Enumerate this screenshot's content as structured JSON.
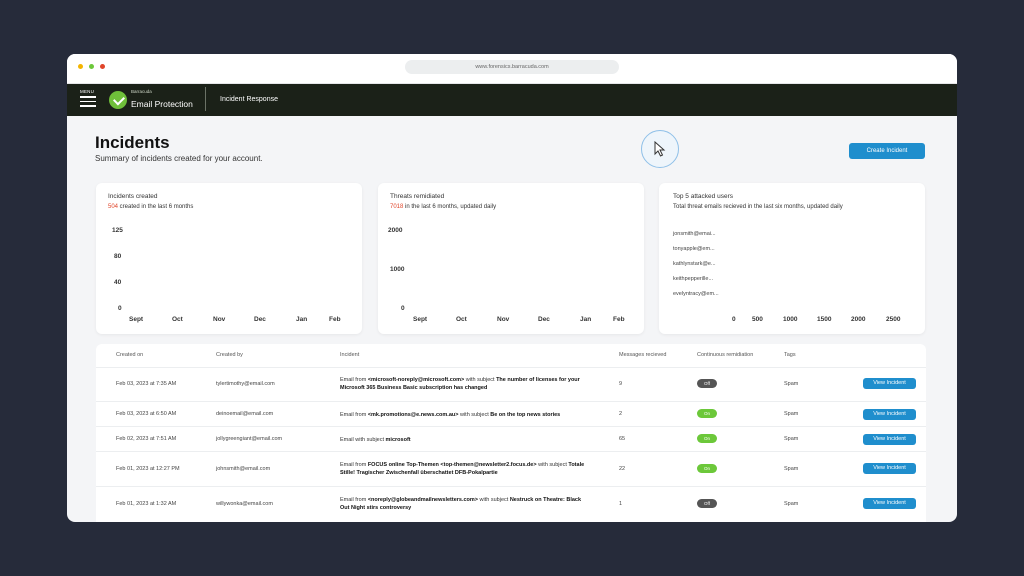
{
  "window": {
    "url": "www.forensics.barracuda.com",
    "dot_colors": [
      "#f4b400",
      "#6cc83a",
      "#e0452a"
    ]
  },
  "appbar": {
    "menu_label": "MENU",
    "brand_small": "Barracuda",
    "brand_name": "Email Protection",
    "section": "Incident Response"
  },
  "page": {
    "title": "Incidents",
    "subtitle": "Summary of incidents created for your account.",
    "create_button": "Create Incident"
  },
  "cards": {
    "incidents": {
      "title": "Incidents created",
      "highlight": "504",
      "subtitle_rest": " created in the last 6 months"
    },
    "threats": {
      "title": "Threats remidiated",
      "highlight": "7018",
      "subtitle_rest": " in the last 6 months, updated daily"
    },
    "top_users": {
      "title": "Top 5 attacked users",
      "subtitle": "Total threat emails recieved in the last six months, updated daily"
    }
  },
  "chart_data": [
    {
      "type": "bar",
      "categories": [
        "Sept",
        "Oct",
        "Nov",
        "Dec",
        "Jan",
        "Feb"
      ],
      "y_ticks": [
        "125",
        "80",
        "40",
        "0"
      ],
      "values": []
    },
    {
      "type": "bar",
      "categories": [
        "Sept",
        "Oct",
        "Nov",
        "Dec",
        "Jan",
        "Feb"
      ],
      "y_ticks": [
        "2000",
        "1000",
        "0"
      ],
      "values": []
    },
    {
      "type": "bar",
      "categories": [
        "jonsmith@emai...",
        "tonyapple@em...",
        "kathlynstark@e...",
        "keithpepperille...",
        "evelyntracy@em..."
      ],
      "x_ticks": [
        "0",
        "500",
        "1000",
        "1500",
        "2000",
        "2500"
      ],
      "values": []
    }
  ],
  "table": {
    "headers": [
      "Created on",
      "Created by",
      "Incident",
      "Messages recieved",
      "Continuous remidiation",
      "Tags"
    ],
    "rows": [
      {
        "created_on": "Feb 03, 2023 at 7:35 AM",
        "created_by": "tylertimothy@email.com",
        "incident_pre": "Email from ",
        "incident_from": "<microsoft-noreply@microsoft.com>",
        "incident_mid": " with subject ",
        "incident_subject": "The number of licenses for your Microsoft 365 Business Basic subscription has changed",
        "messages": "9",
        "remediation": "Off",
        "tags": "Spam",
        "action": "View Incident"
      },
      {
        "created_on": "Feb 03, 2023 at 6:50 AM",
        "created_by": "deinoemail@email.com",
        "incident_pre": "Email from ",
        "incident_from": "<mk.promotions@e.news.com.au>",
        "incident_mid": " with subject ",
        "incident_subject": "Be on the top news stories",
        "messages": "2",
        "remediation": "On",
        "tags": "Spam",
        "action": "View Incident"
      },
      {
        "created_on": "Feb 02, 2023 at 7:51 AM",
        "created_by": "jollygreengiant@email.com",
        "incident_pre": "Email with subject ",
        "incident_from": "",
        "incident_mid": "",
        "incident_subject": "microsoft",
        "messages": "65",
        "remediation": "On",
        "tags": "Spam",
        "action": "View Incident"
      },
      {
        "created_on": "Feb 01, 2023 at 12:27 PM",
        "created_by": "johnsmith@email.com",
        "incident_pre": "Email from ",
        "incident_from": "FOCUS online Top-Themen <top-themen@newsletter2.focus.de>",
        "incident_mid": " with subject ",
        "incident_subject": "Totale Stille! Tragischer Zwischenfall überschattet DFB-Pokalpartie",
        "messages": "22",
        "remediation": "On",
        "tags": "Spam",
        "action": "View Incident"
      },
      {
        "created_on": "Feb 01, 2023 at 1:32 AM",
        "created_by": "willywonka@email.com",
        "incident_pre": "Email from ",
        "incident_from": "<noreply@globeandmailnewsletters.com>",
        "incident_mid": " with subject ",
        "incident_subject": "Nestruck on Theatre: Black Out Night stirs controversy",
        "messages": "1",
        "remediation": "Off",
        "tags": "Spam",
        "action": "View Incident"
      }
    ]
  }
}
